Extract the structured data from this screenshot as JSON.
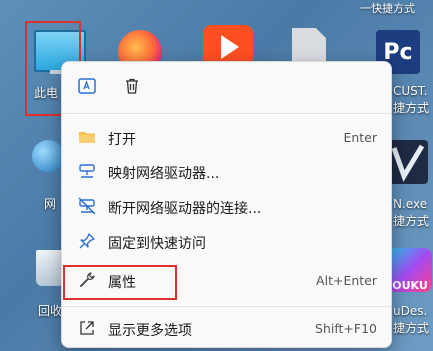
{
  "desktop": {
    "top_text": "一快捷方式",
    "labels": {
      "this_pc": "此电",
      "network": "网",
      "recycle": "回收",
      "pc_label_line1": "CUST.",
      "pc_label_line2": "捷方式",
      "vpn_label_line1": "N.exe",
      "vpn_label_line2": "捷方式",
      "youku_label_line1": "uDes.",
      "youku_label_line2": "捷方式",
      "pc_tile": "Pc",
      "youku_tile": "OUKU"
    }
  },
  "menu": {
    "items": [
      {
        "icon": "folder-icon",
        "label": "打开",
        "shortcut": "Enter"
      },
      {
        "icon": "map-network-drive-icon",
        "label": "映射网络驱动器...",
        "shortcut": ""
      },
      {
        "icon": "disconnect-network-drive-icon",
        "label": "断开网络驱动器的连接...",
        "shortcut": ""
      },
      {
        "icon": "pin-icon",
        "label": "固定到快速访问",
        "shortcut": ""
      },
      {
        "icon": "wrench-icon",
        "label": "属性",
        "shortcut": "Alt+Enter"
      },
      {
        "icon": "more-options-icon",
        "label": "显示更多选项",
        "shortcut": "Shift+F10"
      }
    ]
  },
  "colors": {
    "highlight_box": "#e0302b",
    "menu_bg": "#f9f9f9",
    "accent": "#2a6fd6"
  }
}
